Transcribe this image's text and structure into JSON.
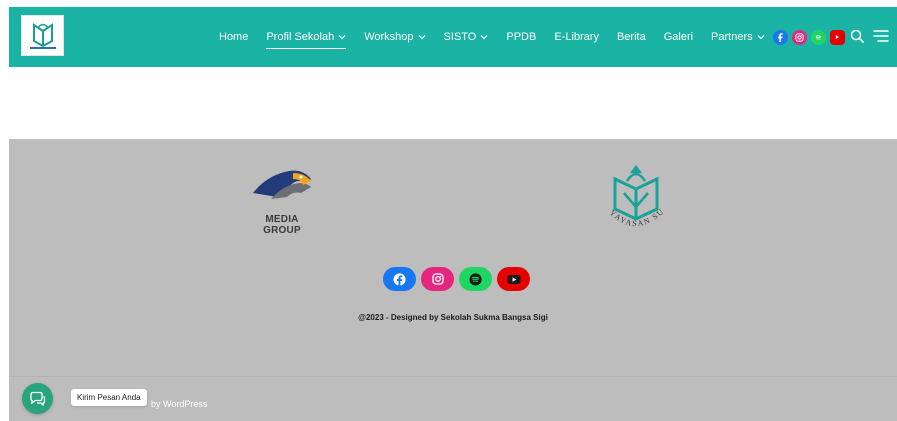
{
  "nav": {
    "items": [
      {
        "label": "Home",
        "dropdown": false,
        "active": false
      },
      {
        "label": "Profil Sekolah",
        "dropdown": true,
        "active": true
      },
      {
        "label": "Workshop",
        "dropdown": true,
        "active": false
      },
      {
        "label": "SISTO",
        "dropdown": true,
        "active": false
      },
      {
        "label": "PPDB",
        "dropdown": false,
        "active": false
      },
      {
        "label": "E-Library",
        "dropdown": false,
        "active": false
      },
      {
        "label": "Berita",
        "dropdown": false,
        "active": false
      },
      {
        "label": "Galeri",
        "dropdown": false,
        "active": false
      },
      {
        "label": "Partners",
        "dropdown": true,
        "active": false
      }
    ],
    "social_icons": [
      "facebook-icon",
      "instagram-icon",
      "spotify-icon",
      "youtube-icon"
    ]
  },
  "footer": {
    "media_group_label": "MEDIA GROUP",
    "yayasan_label": "YAYASAN SUKMA",
    "copyright": "@2023 - Designed by Sekolah Sukma Bangsa Sigi",
    "powered_suffix": "by WordPress",
    "chat_tooltip": "Kirim Pesan Anda"
  },
  "colors": {
    "header_bg": "#1bb3a4",
    "footer_bg": "#bdbdbd",
    "facebook": "#1877f2",
    "instagram": "#e4267e",
    "spotify": "#1ed760",
    "youtube": "#e60000",
    "chat": "#2aa47d"
  }
}
